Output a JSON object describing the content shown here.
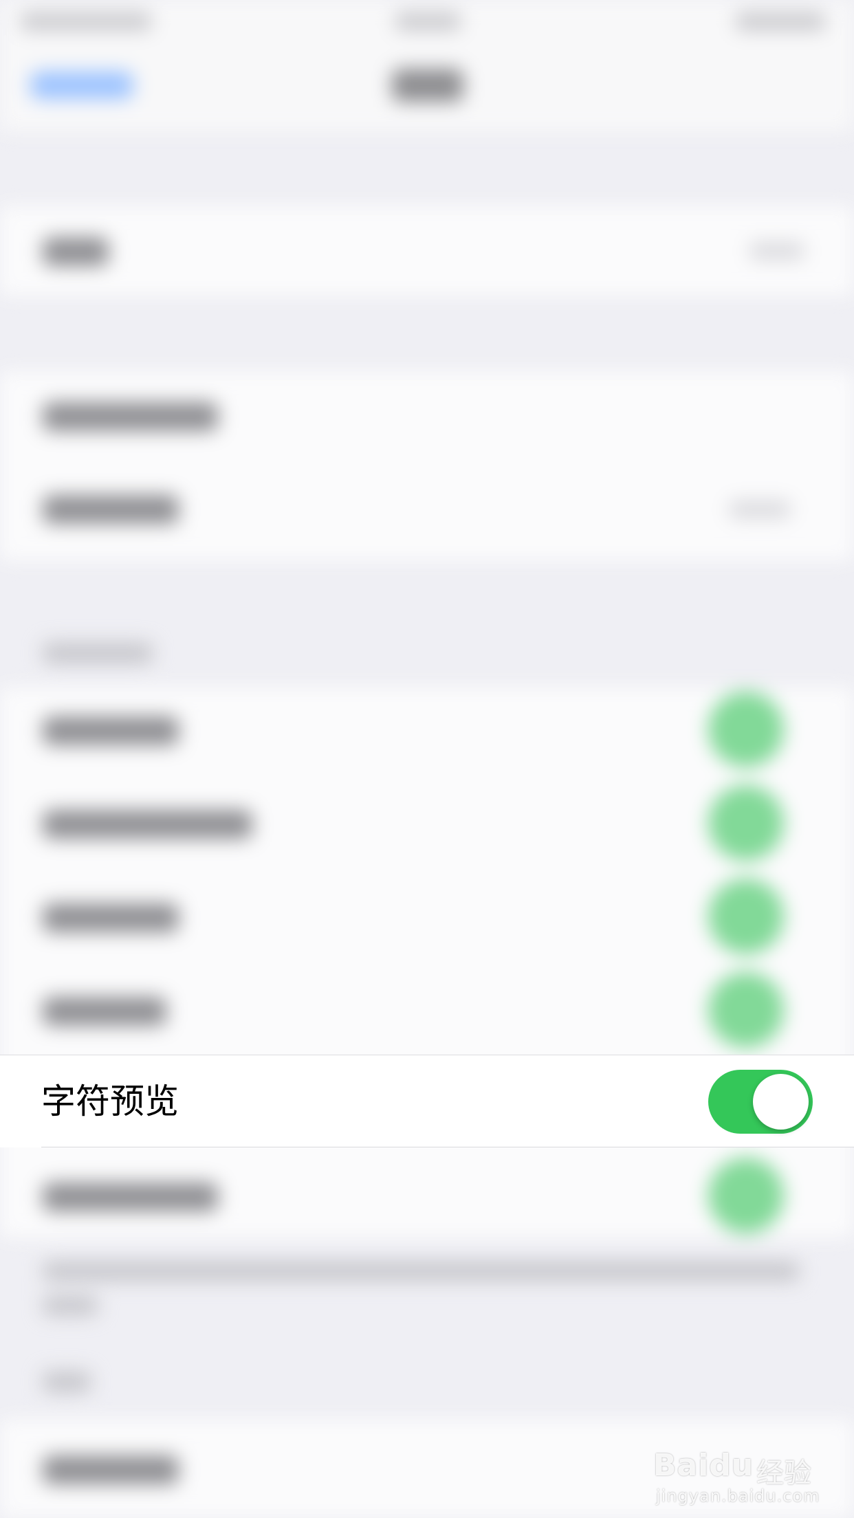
{
  "settings_row": {
    "label": "字符预览",
    "toggle_on": true
  },
  "colors": {
    "toggle_on": "#34c759",
    "page_bg": "#efeff4",
    "cell_bg": "#ffffff"
  },
  "watermark": {
    "logo": "Baidu",
    "brand_cn": "经验",
    "url": "jingyan.baidu.com"
  }
}
